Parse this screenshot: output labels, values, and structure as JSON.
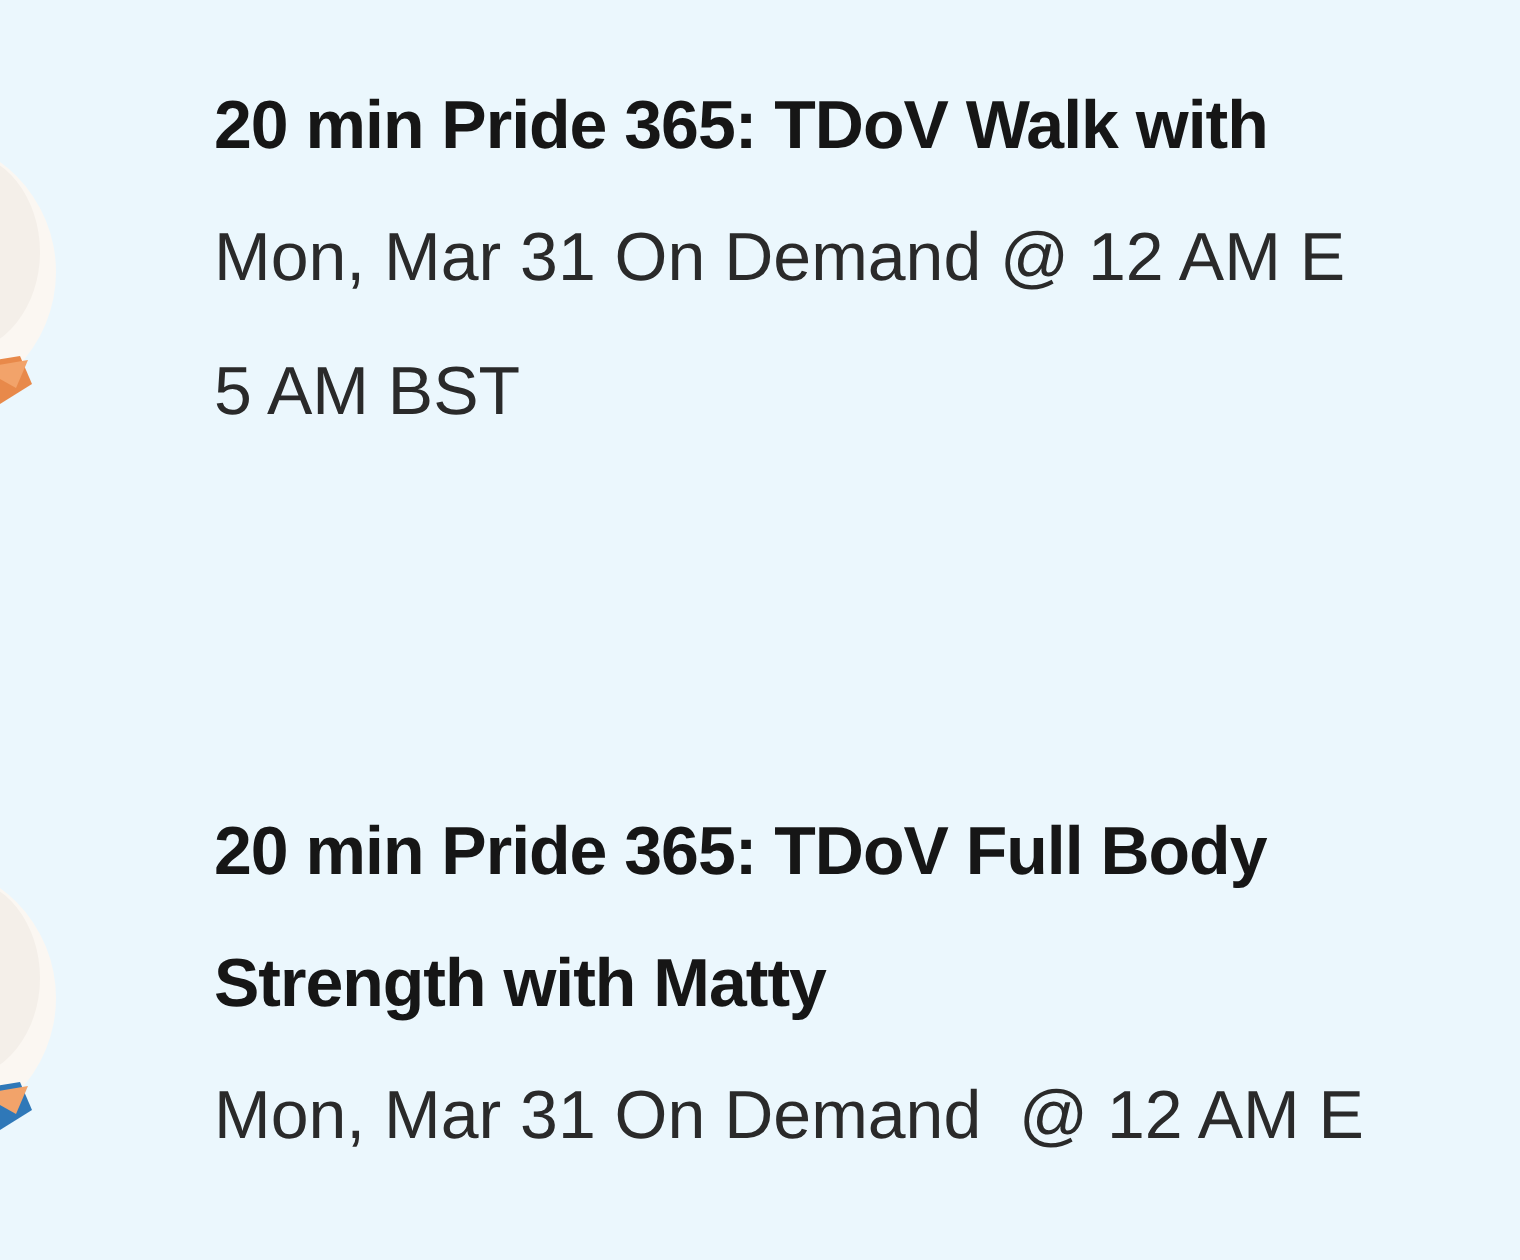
{
  "sessions": [
    {
      "thumbnail": {
        "kind": "picture"
      },
      "title": "20 min Pride 365: TDoV Walk with",
      "schedule_lines": [
        "Mon, Mar 31 On Demand @ 12 AM E",
        "5 AM BST"
      ]
    },
    {
      "thumbnail": {
        "kind": "picture"
      },
      "title": "20 min Pride 365: TDoV Full Body Strength with Matty",
      "schedule_lines": [
        "Mon, Mar 31 On Demand  @ 12 AM E"
      ]
    }
  ]
}
